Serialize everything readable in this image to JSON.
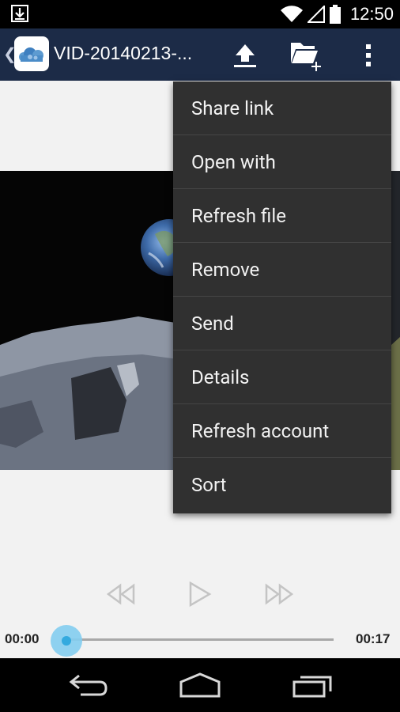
{
  "status_bar": {
    "time": "12:50",
    "icons": [
      "download-notification-icon",
      "wifi-icon",
      "cell-signal-icon",
      "battery-icon"
    ]
  },
  "action_bar": {
    "title": "VID-20140213-...",
    "icons": [
      "back-chevron-icon",
      "owncloud-logo-icon",
      "upload-icon",
      "new-folder-icon",
      "overflow-menu-icon"
    ],
    "background": "#1c2b47"
  },
  "overflow_menu": {
    "items": [
      "Share link",
      "Open with",
      "Refresh file",
      "Remove",
      "Send",
      "Details",
      "Refresh account",
      "Sort"
    ],
    "background": "#303030"
  },
  "media_controls": {
    "current_time": "00:00",
    "duration": "00:17",
    "progress": 0,
    "buttons": [
      "rewind-icon",
      "play-icon",
      "fast-forward-icon"
    ],
    "accent": "#33aadf"
  },
  "nav_bar": {
    "buttons": [
      "back-icon",
      "home-icon",
      "recent-apps-icon"
    ]
  }
}
